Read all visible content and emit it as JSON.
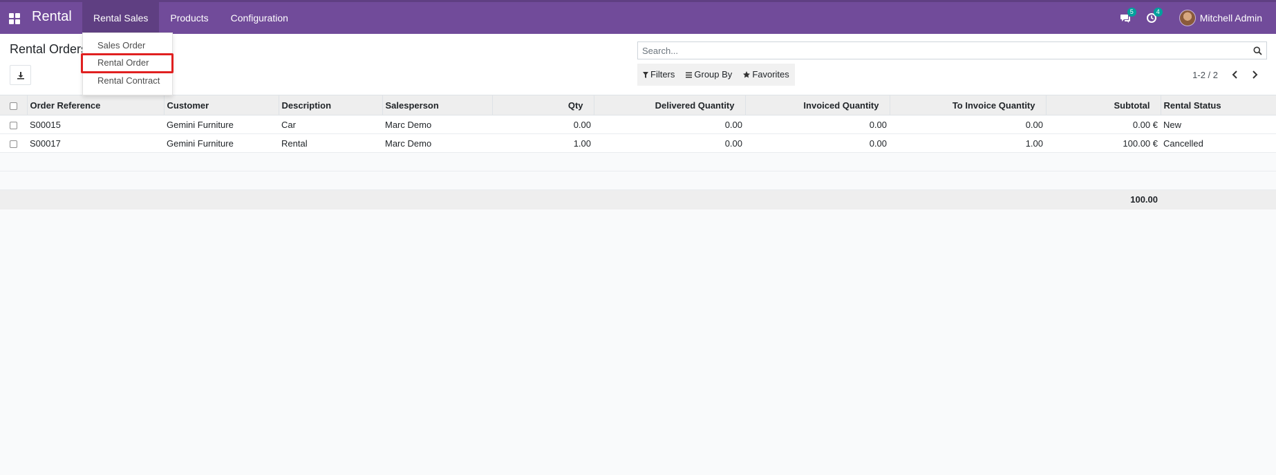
{
  "navbar": {
    "brand": "Rental",
    "menu": [
      {
        "label": "Rental Sales",
        "active": true
      },
      {
        "label": "Products",
        "active": false
      },
      {
        "label": "Configuration",
        "active": false
      }
    ],
    "messages_count": "5",
    "activities_count": "4",
    "user_name": "Mitchell Admin",
    "accent_color": "#714b9a"
  },
  "dropdown": {
    "items": [
      "Sales Order",
      "Rental Order",
      "Rental Contract"
    ],
    "highlighted": "Rental Order"
  },
  "control": {
    "title": "Rental Orders",
    "search_placeholder": "Search...",
    "filters_label": "Filters",
    "groupby_label": "Group By",
    "favorites_label": "Favorites",
    "pager": "1-2 / 2"
  },
  "table": {
    "columns": [
      "Order Reference",
      "Customer",
      "Description",
      "Salesperson",
      "Qty",
      "Delivered Quantity",
      "Invoiced Quantity",
      "To Invoice Quantity",
      "Subtotal",
      "Rental Status"
    ],
    "rows": [
      [
        "S00015",
        "Gemini Furniture",
        "Car",
        "Marc Demo",
        "0.00",
        "0.00",
        "0.00",
        "0.00",
        "0.00 €",
        "New"
      ],
      [
        "S00017",
        "Gemini Furniture",
        "Rental",
        "Marc Demo",
        "1.00",
        "0.00",
        "0.00",
        "1.00",
        "100.00 €",
        "Cancelled"
      ]
    ],
    "total_subtotal": "100.00"
  }
}
